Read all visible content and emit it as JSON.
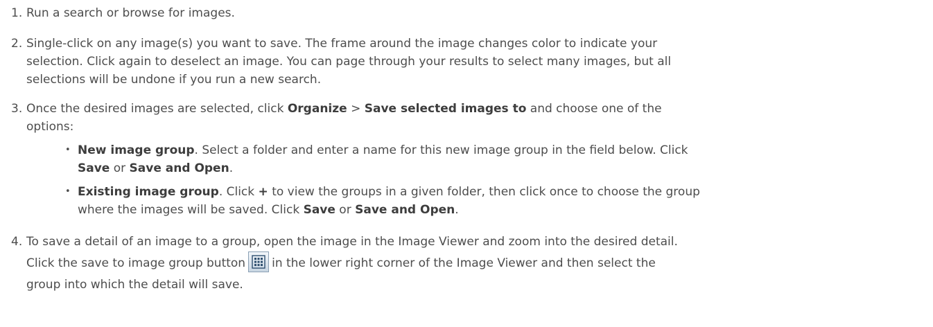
{
  "steps": [
    {
      "num": "1.",
      "lines": [
        "Run a search or browse for images."
      ]
    },
    {
      "num": "2.",
      "lines": [
        "Single-click on any image(s) you want to save. The frame around the image changes color to indicate your",
        "selection. Click again to deselect an image. You can page through your results to select many images, but all",
        "selections will be undone if you run a new search."
      ]
    },
    {
      "num": "3.",
      "l1_a": "Once the desired images are selected, click ",
      "l1_b": "Organize",
      "l1_c": " > ",
      "l1_d": "Save selected images to",
      "l1_e": " and choose one of the",
      "l2": "options:"
    },
    {
      "num": "4.",
      "l1": "To save a detail of an image to a group, open the image in the Image Viewer and zoom into the desired detail.",
      "l2_a": "Click the save to image group button",
      "l2_b": "in the lower right corner of the Image Viewer and then select the",
      "l3": "group into which the detail will save."
    }
  ],
  "bullets": [
    {
      "dot": "•",
      "b1": "New image group",
      "t1": ". Select a folder and enter a name for this new image group in the field below. Click",
      "b2": "Save",
      "t2": " or ",
      "b3": "Save and Open",
      "t3": "."
    },
    {
      "dot": "•",
      "b1": "Existing image group",
      "t1": ". Click ",
      "b_plus": "+",
      "t1b": " to view the groups in a given folder, then click once to choose the group",
      "t2a": "where the images will be saved. Click ",
      "b2": "Save",
      "t2": " or ",
      "b3": "Save and Open",
      "t3": "."
    }
  ],
  "icons": {
    "save_to_group": "grid-icon"
  }
}
